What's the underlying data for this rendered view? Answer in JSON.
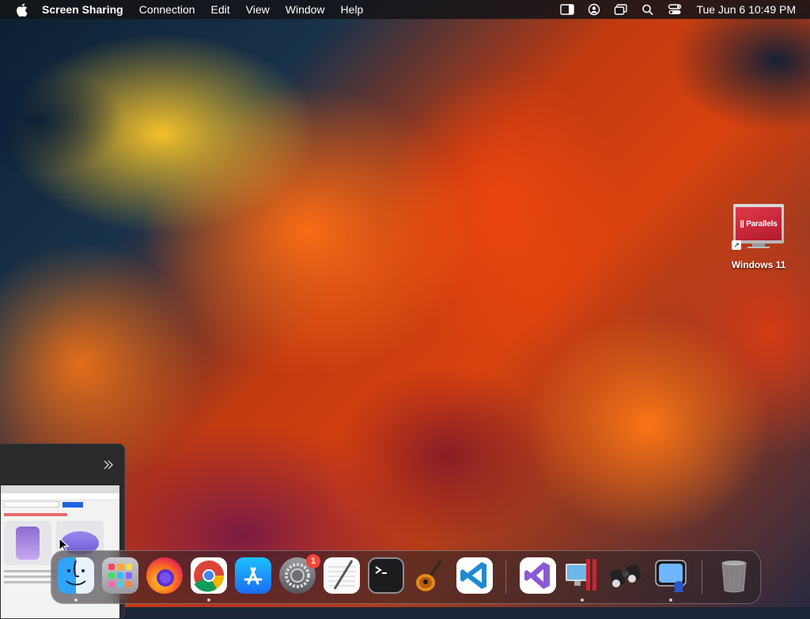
{
  "menubar": {
    "app_name": "Screen Sharing",
    "menus": [
      "Connection",
      "Edit",
      "View",
      "Window",
      "Help"
    ],
    "clock": "Tue Jun 6  10:49 PM"
  },
  "desktop_icons": [
    {
      "label": "Windows 11",
      "screen_text": "|| Parallels"
    }
  ],
  "dock": {
    "apps": [
      {
        "name": "Finder"
      },
      {
        "name": "Launchpad"
      },
      {
        "name": "Firefox"
      },
      {
        "name": "Google Chrome"
      },
      {
        "name": "App Store"
      },
      {
        "name": "System Settings",
        "badge": "1"
      },
      {
        "name": "TextEdit"
      },
      {
        "name": "Terminal"
      },
      {
        "name": "GarageBand"
      },
      {
        "name": "Visual Studio Code"
      },
      {
        "name": "Visual Studio"
      },
      {
        "name": "Parallels Desktop"
      },
      {
        "name": "Network Radar"
      },
      {
        "name": "Screen Sharing"
      },
      {
        "name": "Trash"
      }
    ]
  },
  "colors": {
    "menubar_bg": "#141418",
    "badge": "#f0463b",
    "parallels_red": "#c8202e"
  }
}
